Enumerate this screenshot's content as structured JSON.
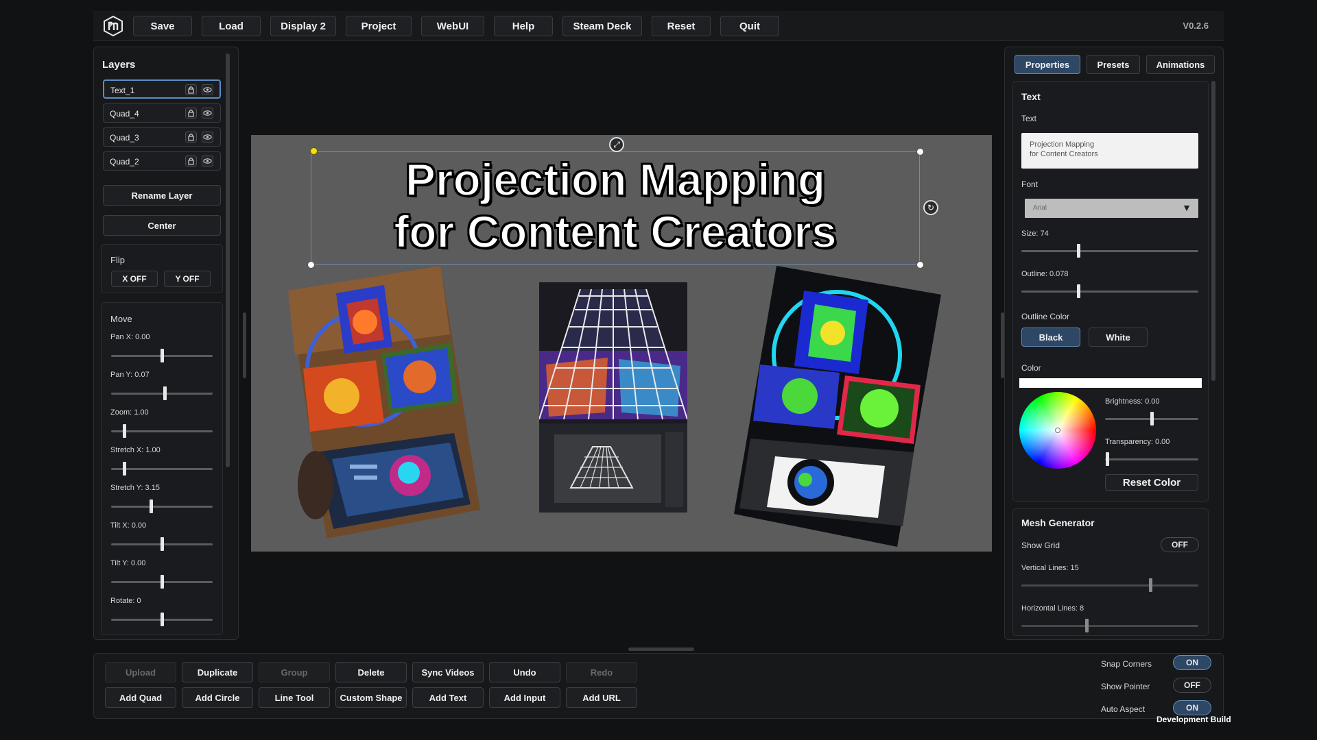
{
  "toolbar": {
    "buttons": [
      "Save",
      "Load",
      "Display 2",
      "Project",
      "WebUI",
      "Help",
      "Steam Deck",
      "Reset",
      "Quit"
    ],
    "version": "V0.2.6"
  },
  "layers_panel": {
    "title": "Layers",
    "layers": [
      "Text_1",
      "Quad_4",
      "Quad_3",
      "Quad_2"
    ],
    "rename_label": "Rename Layer",
    "center_label": "Center",
    "flip": {
      "title": "Flip",
      "x_label": "X OFF",
      "y_label": "Y OFF"
    },
    "move": {
      "title": "Move",
      "sliders": [
        {
          "label": "Pan X: 0.00",
          "fraction": 0.5
        },
        {
          "label": "Pan Y: 0.07",
          "fraction": 0.53
        },
        {
          "label": "Zoom: 1.00",
          "fraction": 0.13
        },
        {
          "label": "Stretch X: 1.00",
          "fraction": 0.13
        },
        {
          "label": "Stretch Y: 3.15",
          "fraction": 0.39
        },
        {
          "label": "Tilt X: 0.00",
          "fraction": 0.5
        },
        {
          "label": "Tilt Y: 0.00",
          "fraction": 0.5
        },
        {
          "label": "Rotate: 0",
          "fraction": 0.5
        }
      ]
    }
  },
  "canvas": {
    "title_line1": "Projection Mapping",
    "title_line2": "for Content Creators"
  },
  "right_panel": {
    "tabs": [
      "Properties",
      "Presets",
      "Animations"
    ],
    "active_tab": "Properties",
    "text_section": {
      "title": "Text",
      "text_label": "Text",
      "text_value_line1": "Projection Mapping",
      "text_value_line2": "for Content Creators",
      "font_label": "Font",
      "font_value": "Arial",
      "size_label": "Size: 74",
      "size_fraction": 0.32,
      "outline_label": "Outline: 0.078",
      "outline_fraction": 0.32,
      "outline_color_label": "Outline Color",
      "outline_black": "Black",
      "outline_white": "White",
      "color_label": "Color",
      "color_swatch": "#ffffff",
      "brightness_label": "Brightness: 0.00",
      "brightness_fraction": 0.5,
      "transparency_label": "Transparency: 0.00",
      "transparency_fraction": 0.0,
      "reset_color": "Reset Color"
    },
    "mesh_section": {
      "title": "Mesh Generator",
      "show_grid_label": "Show Grid",
      "show_grid_value": "OFF",
      "vertical_label": "Vertical Lines: 15",
      "vertical_fraction": 0.73,
      "horizontal_label": "Horizontal Lines: 8",
      "horizontal_fraction": 0.37
    }
  },
  "bottom_bar": {
    "row1": [
      {
        "label": "Upload",
        "enabled": false
      },
      {
        "label": "Duplicate",
        "enabled": true
      },
      {
        "label": "Group",
        "enabled": false
      },
      {
        "label": "Delete",
        "enabled": true
      },
      {
        "label": "Sync Videos",
        "enabled": true
      },
      {
        "label": "Undo",
        "enabled": true
      },
      {
        "label": "Redo",
        "enabled": false
      }
    ],
    "row2": [
      "Add Quad",
      "Add Circle",
      "Line Tool",
      "Custom Shape",
      "Add Text",
      "Add Input",
      "Add URL"
    ],
    "toggles": [
      {
        "label": "Snap Corners",
        "value": "ON"
      },
      {
        "label": "Show Pointer",
        "value": "OFF"
      },
      {
        "label": "Auto Aspect",
        "value": "ON"
      }
    ],
    "dev_build": "Development Build"
  },
  "colors": {
    "accent": "#2d4765",
    "accent_border": "#5f86b0",
    "canvas_bg": "#5c5c5c",
    "handle_yellow": "#f3df1a"
  }
}
